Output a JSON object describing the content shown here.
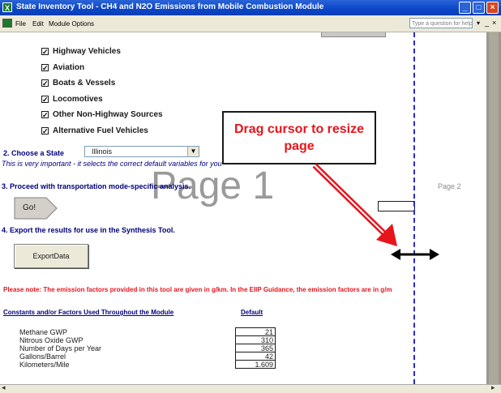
{
  "window": {
    "title": "State Inventory Tool - CH4 and N2O Emissions from Mobile Combustion Module"
  },
  "menu": {
    "file": "File",
    "edit": "Edit",
    "module_options": "Module Options",
    "ask_placeholder": "Type a question for help"
  },
  "categories": [
    {
      "label": "Highway Vehicles",
      "checked": true
    },
    {
      "label": "Aviation",
      "checked": true
    },
    {
      "label": "Boats & Vessels",
      "checked": true
    },
    {
      "label": "Locomotives",
      "checked": true
    },
    {
      "label": "Other Non-Highway Sources",
      "checked": true
    },
    {
      "label": "Alternative Fuel Vehicles",
      "checked": true
    }
  ],
  "step2": {
    "heading": "2. Choose a State",
    "state_value": "Illinois",
    "note": "This is very important - it selects the correct default variables for you"
  },
  "step3": {
    "heading": "3. Proceed with transportation mode-specific analysis.",
    "button": "Go!"
  },
  "step4": {
    "heading": "4. Export the results for use in the Synthesis Tool.",
    "button": "ExportData"
  },
  "watermarks": {
    "page1": "Page 1",
    "page2": "Page 2"
  },
  "callout": {
    "text": "Drag cursor to resize page"
  },
  "note": "Please note: The emission factors provided in this tool are given in g/km.  In the EIIP Guidance, the emission factors are in g/m",
  "constants": {
    "heading": "Constants and/or Factors Used Throughout the Module",
    "default_header": "Default",
    "rows": [
      {
        "label": "Methane GWP",
        "value": "21"
      },
      {
        "label": "Nitrous Oxide GWP",
        "value": "310"
      },
      {
        "label": "Number of Days per Year",
        "value": "365"
      },
      {
        "label": "Gallons/Barrel",
        "value": "42"
      },
      {
        "label": "Kilometers/Mile",
        "value": "1.609"
      }
    ]
  },
  "colors": {
    "titlebar": "#0a46c8",
    "callout_text": "#e8141b",
    "arrow": "#e8141b",
    "pagebreak": "#2a2ac8",
    "heading": "#000080"
  }
}
